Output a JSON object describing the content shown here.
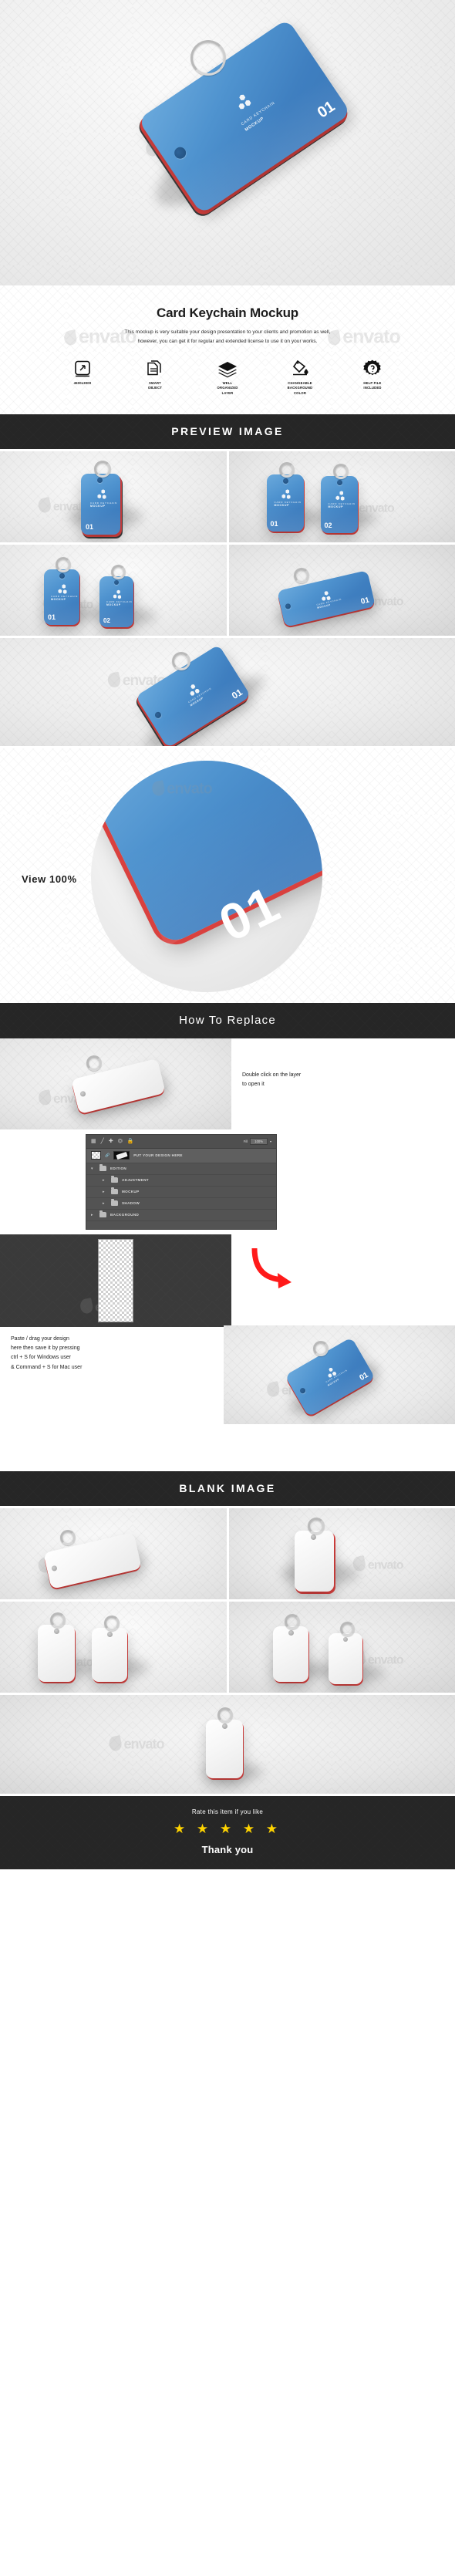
{
  "hero": {
    "card": {
      "brand_line1": "CARD KEYCHAIN",
      "brand_line2": "MOCKUP",
      "number": "01"
    },
    "watermark": "envato"
  },
  "intro": {
    "title": "Card Keychain Mockup",
    "description_line1": "This mockup is very suitable your design presentation to your clients and promotion as well,",
    "description_line2": "however, you can get it for regular and extended license to use it on your works.",
    "features": [
      {
        "icon": "resize-icon",
        "caption": "4500x3000"
      },
      {
        "icon": "smart-object-icon",
        "caption_line1": "SMART",
        "caption_line2": "OBJECT"
      },
      {
        "icon": "layers-icon",
        "caption_line1": "WELL",
        "caption_line2": "ORGANIZED",
        "caption_line3": "LAYER"
      },
      {
        "icon": "paint-bucket-icon",
        "caption_line1": "CHANGEABLE",
        "caption_line2": "BACKGROUND",
        "caption_line3": "COLOR"
      },
      {
        "icon": "help-gear-icon",
        "caption_line1": "HELP FILE",
        "caption_line2": "INCLUDED"
      }
    ]
  },
  "preview_section": {
    "banner_title": "PREVIEW IMAGE",
    "cells": [
      {
        "id": "preview-cell-1",
        "numbers": [
          "01"
        ]
      },
      {
        "id": "preview-cell-2",
        "numbers": [
          "01",
          "02"
        ]
      },
      {
        "id": "preview-cell-3",
        "numbers": [
          "01",
          "02"
        ]
      },
      {
        "id": "preview-cell-4",
        "numbers": [
          "01"
        ]
      },
      {
        "id": "preview-cell-5",
        "numbers": [
          "01"
        ]
      }
    ]
  },
  "view_section": {
    "label": "View 100%",
    "number": "01"
  },
  "howto_section": {
    "banner_title": "How To Replace",
    "step1_line1": "Double click on the layer",
    "step1_line2": "to open it",
    "step2_line1": "Paste / drag your design",
    "step2_line2": "here then save it by pressing",
    "step2_line3": "ctrl + S for Windows user",
    "step2_line4": "& Command + S for Mac user",
    "layers_panel": {
      "fill_label": "Fill",
      "fill_value": "100%",
      "rows": [
        {
          "name": "PUT YOUR DESIGN HERE",
          "type": "smart-object",
          "selected": true
        },
        {
          "name": "EDITION",
          "type": "group",
          "expanded": true,
          "indent": 0
        },
        {
          "name": "ADJUSTMENT",
          "type": "group",
          "expanded": false,
          "indent": 1
        },
        {
          "name": "MOCKUP",
          "type": "group",
          "expanded": false,
          "indent": 1
        },
        {
          "name": "SHADOW",
          "type": "group",
          "expanded": false,
          "indent": 1
        },
        {
          "name": "BACKGROUND",
          "type": "group",
          "expanded": false,
          "indent": 0
        }
      ]
    }
  },
  "blank_section": {
    "banner_title": "BLANK IMAGE"
  },
  "footer": {
    "rate_text": "Rate this item if you like",
    "stars": "★ ★ ★ ★ ★",
    "star_count": 5,
    "thank_you": "Thank you"
  },
  "colors": {
    "card_blue": "#4a8cca",
    "card_red_edge": "#d9413f",
    "banner_dark": "#262626",
    "star_yellow": "#ffd400",
    "arrow_red": "#ff1a1a"
  }
}
